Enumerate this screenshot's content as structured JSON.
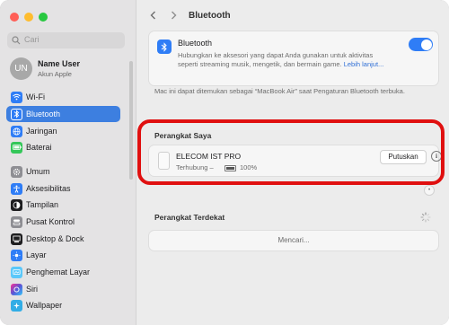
{
  "sidebar": {
    "search_placeholder": "Cari",
    "profile": {
      "initials": "UN",
      "name": "Name User",
      "subtitle": "Akun Apple"
    },
    "items": [
      {
        "label": "Wi-Fi",
        "icon": "wifi-icon",
        "color": "#2f7df6",
        "active": false
      },
      {
        "label": "Bluetooth",
        "icon": "bluetooth-icon",
        "color": "#2f7df6",
        "active": true
      },
      {
        "label": "Jaringan",
        "icon": "globe-icon",
        "color": "#2f7df6",
        "active": false
      },
      {
        "label": "Baterai",
        "icon": "battery-icon",
        "color": "#34c759",
        "active": false
      },
      {
        "label": "Umum",
        "icon": "gear-icon",
        "color": "#8e8e93",
        "active": false
      },
      {
        "label": "Aksesibilitas",
        "icon": "accessibility-icon",
        "color": "#2f7df6",
        "active": false
      },
      {
        "label": "Tampilan",
        "icon": "appearance-icon",
        "color": "#1d1d1f",
        "active": false
      },
      {
        "label": "Pusat Kontrol",
        "icon": "control-center-icon",
        "color": "#8e8e93",
        "active": false
      },
      {
        "label": "Desktop & Dock",
        "icon": "dock-icon",
        "color": "#1d1d1f",
        "active": false
      },
      {
        "label": "Layar",
        "icon": "display-icon",
        "color": "#2f7df6",
        "active": false
      },
      {
        "label": "Penghemat Layar",
        "icon": "screensaver-icon",
        "color": "#5ac8fa",
        "active": false
      },
      {
        "label": "Siri",
        "icon": "siri-icon",
        "color": "#5856d6",
        "active": false
      },
      {
        "label": "Wallpaper",
        "icon": "wallpaper-icon",
        "color": "#32ade6",
        "active": false
      }
    ]
  },
  "header": {
    "title": "Bluetooth"
  },
  "bluetooth": {
    "title": "Bluetooth",
    "description": "Hubungkan ke aksesori yang dapat Anda gunakan untuk aktivitas seperti streaming musik, mengetik, dan bermain game.",
    "link": "Lebih lanjut...",
    "enabled": true
  },
  "mac_note": "Mac ini dapat ditemukan sebagai “MacBook Air” saat Pengaturan Bluetooth terbuka.",
  "my_devices": {
    "title": "Perangkat Saya",
    "device": {
      "name": "ELECOM IST PRO",
      "status": "Terhubung –",
      "battery": "100%",
      "battery_level": 1.0,
      "disconnect_label": "Putuskan"
    }
  },
  "nearby": {
    "title": "Perangkat Terdekat",
    "searching": "Mencari..."
  },
  "colors": {
    "accent": "#2f7df6",
    "highlight": "#e01010"
  }
}
